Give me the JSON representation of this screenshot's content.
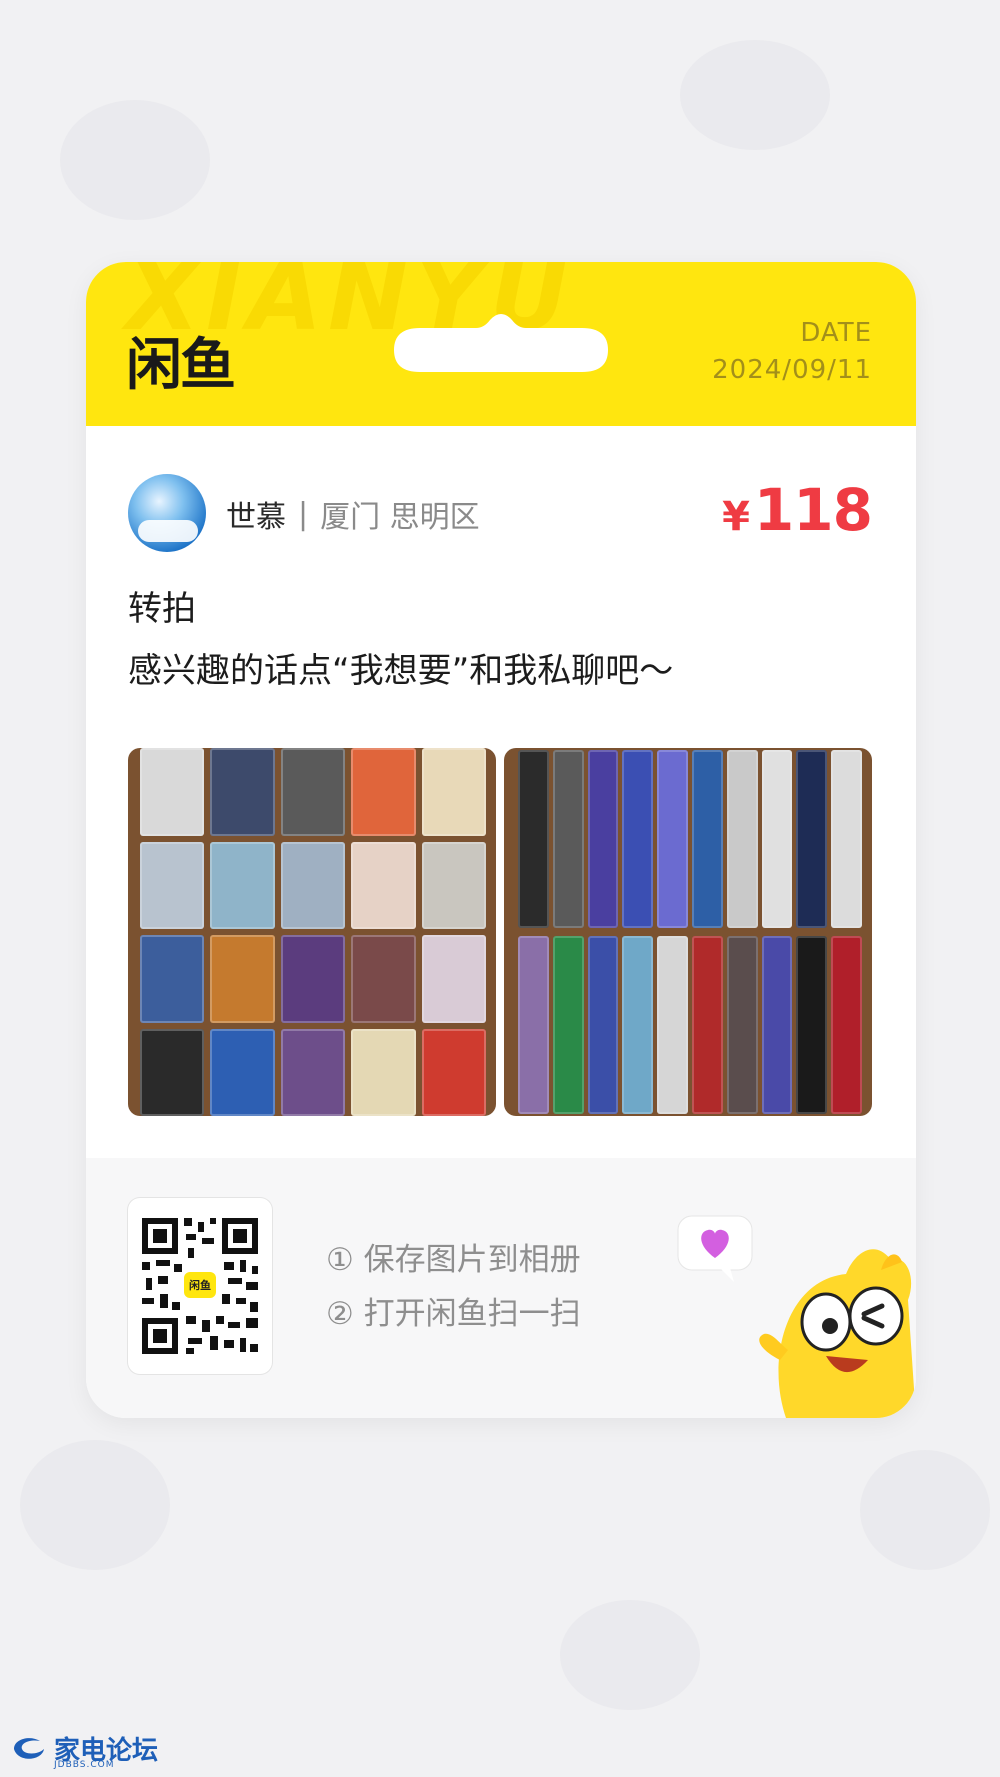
{
  "header": {
    "logo": "闲鱼",
    "watermark": "XIANYU",
    "date_label": "DATE",
    "date_value": "2024/09/11"
  },
  "listing": {
    "seller_name": "世慕",
    "separator": "|",
    "location": "厦门 思明区",
    "price_currency": "¥",
    "price_value": "118",
    "title": "转拍",
    "description": "感兴趣的话点“我想要”和我私聊吧～"
  },
  "footer": {
    "qr_badge": "闲鱼",
    "step1": "① 保存图片到相册",
    "step2": "② 打开闲鱼扫一扫"
  },
  "site": {
    "name": "家电论坛",
    "domain": "JDBBS.COM"
  },
  "colors": {
    "brand_yellow": "#ffe60f",
    "price_red": "#ef3b43",
    "background": "#f1f1f3"
  },
  "icons": [
    "avatar",
    "qr-code",
    "mascot",
    "heart-bubble",
    "site-logo"
  ]
}
